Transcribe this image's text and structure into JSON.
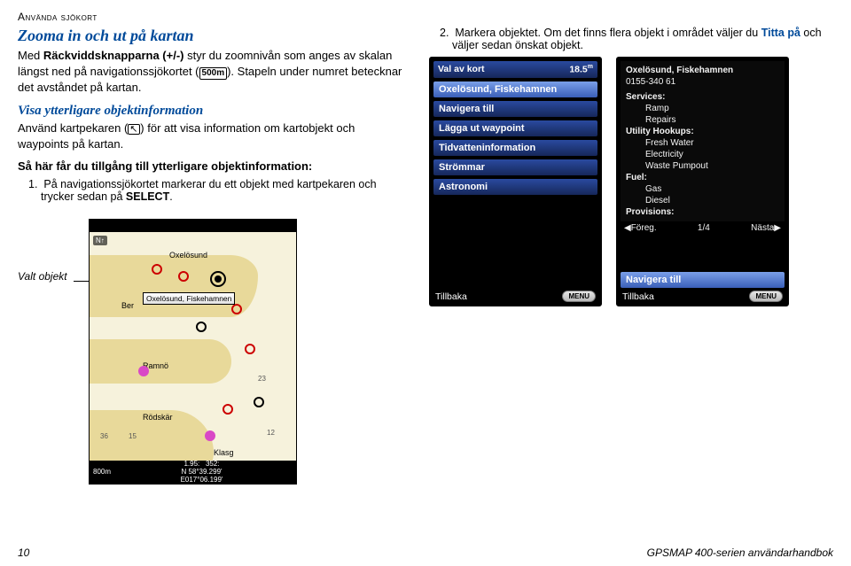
{
  "header": {
    "section": "Använda sjökort"
  },
  "left": {
    "h_zoom": "Zooma in och ut på kartan",
    "p_zoom_a": "Med ",
    "p_zoom_bold": "Räckviddsknapparna (+/-)",
    "p_zoom_b": " styr du zoomnivån som anges av skalan längst ned på navigationssjökortet (",
    "scale_chip": "500m",
    "p_zoom_c": "). Stapeln under numret betecknar det avståndet på kartan.",
    "h_info": "Visa ytterligare objektinformation",
    "p_info_a": "Använd kartpekaren (",
    "p_info_b": ") för att visa information om kartobjekt och waypoints på kartan.",
    "steps_head": "Så här får du tillgång till ytterligare objektinformation:",
    "steps": [
      {
        "num": "1.",
        "text_a": "På navigationssjökortet markerar du ett objekt med kartpekaren och trycker sedan på ",
        "kw": "SELECT",
        "text_b": "."
      }
    ],
    "valt": "Valt objekt"
  },
  "right": {
    "steps": [
      {
        "num": "2.",
        "text_a": "Markera objektet. Om det finns flera objekt i området väljer du ",
        "kw": "Titta på",
        "text_b": " och väljer sedan önskat objekt."
      }
    ]
  },
  "dev1": {
    "title_l": "Val av kort",
    "title_r": "18.5",
    "unit": "m",
    "items": [
      "Oxelösund, Fiskehamnen",
      "Navigera till",
      "Lägga ut waypoint",
      "Tidvatteninformation",
      "Strömmar",
      "Astronomi"
    ],
    "back": "Tillbaka",
    "menu": "MENU"
  },
  "dev2": {
    "head": "Oxelösund, Fiskehamnen",
    "sub": "0155-340 61",
    "services_lbl": "Services:",
    "services": [
      "Ramp",
      "Repairs"
    ],
    "hook_lbl": "Utility Hookups:",
    "hook": [
      "Fresh Water",
      "Electricity",
      "Waste Pumpout"
    ],
    "fuel_lbl": "Fuel:",
    "fuel": [
      "Gas",
      "Diesel"
    ],
    "prov_lbl": "Provisions:",
    "prev": "◀Föreg.",
    "page": "1/4",
    "next": "Nästa▶",
    "nav": "Navigera till",
    "back": "Tillbaka",
    "menu": "MENU"
  },
  "chart": {
    "top_l": "",
    "top_r": "",
    "compass": "N↑",
    "places": {
      "oxel": "Oxelösund",
      "ber": "Ber",
      "ramno": "Ramnö",
      "rodskar": "Rödskär",
      "klasg": "Klasg"
    },
    "tooltip": "Oxelösund, Fiskehamnen",
    "depths": {
      "a": "36",
      "b": "15",
      "c": "23",
      "d": "12"
    },
    "bot": {
      "scale": "800m",
      "rng": "1.95:",
      "brg": "352:",
      "lat": "N 58°39.299'",
      "lon": "E017°06.199'"
    }
  },
  "footer": {
    "page": "10",
    "book": "GPSMAP 400-serien användarhandbok"
  }
}
